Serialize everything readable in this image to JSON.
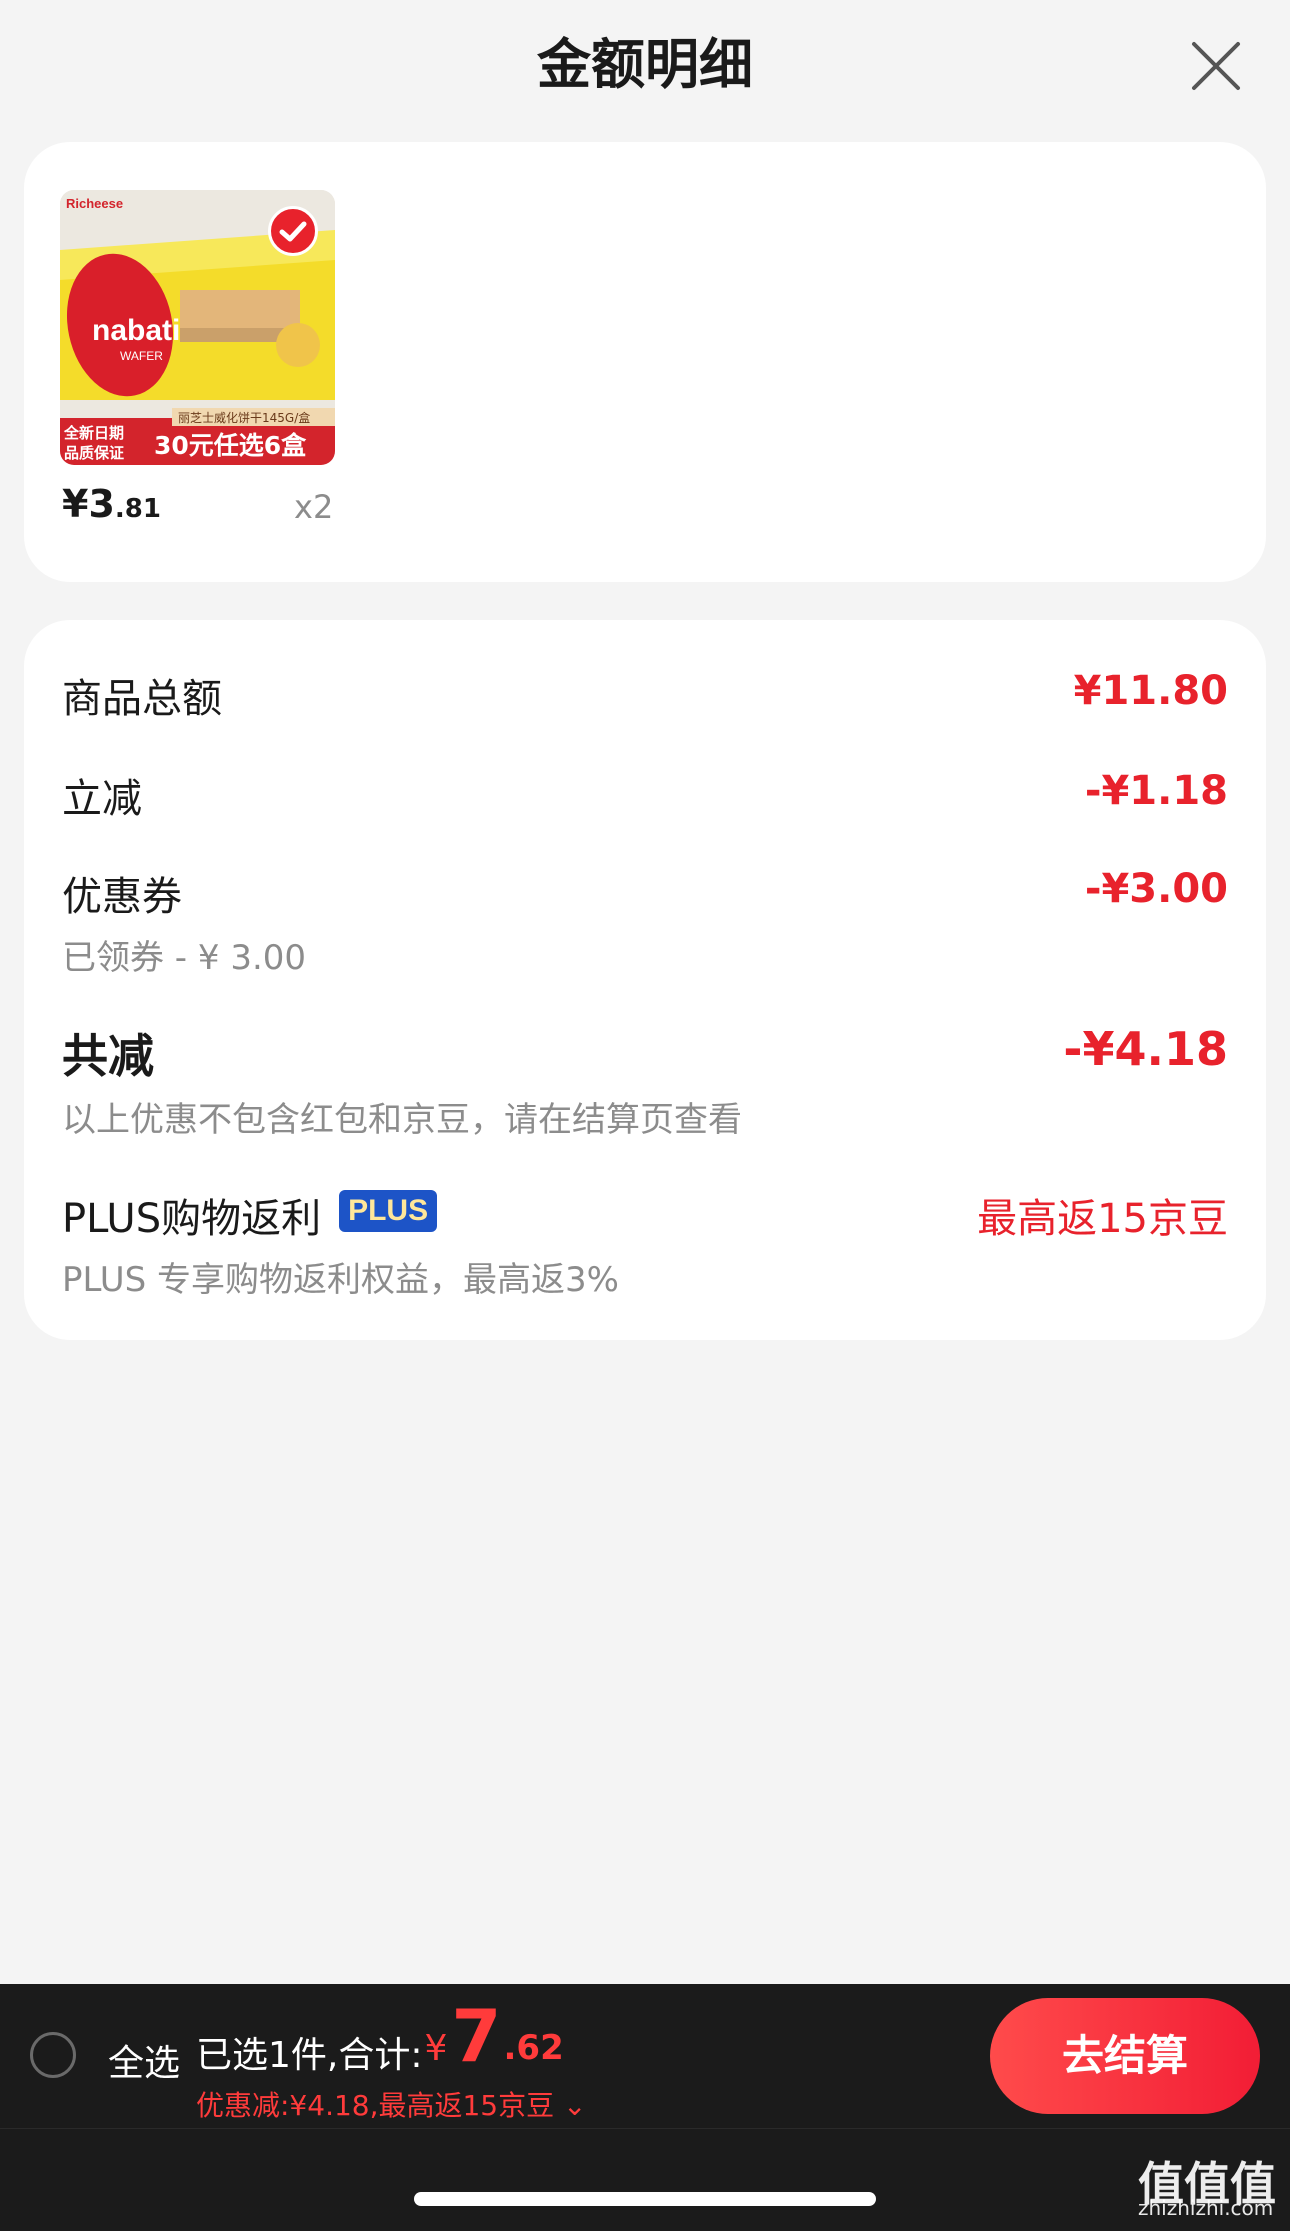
{
  "header": {
    "title": "金额明细"
  },
  "product": {
    "image_brand": "Richeese",
    "image_logo": "nabati",
    "image_logo_sub": "WAFER",
    "image_caption": "丽芝士威化饼干145G/盒",
    "image_promo_line1": "全新日期",
    "image_promo_line2": "品质保证",
    "image_promo_big": "30元任选6盒",
    "price_int": "¥3",
    "price_dec": ".81",
    "quantity": "x2",
    "selected": true
  },
  "summary": {
    "goods_total": {
      "label": "商品总额",
      "value": "¥11.80"
    },
    "instant": {
      "label": "立减",
      "value": "-¥1.18"
    },
    "coupon": {
      "label": "优惠券",
      "value": "-¥3.00",
      "sub": "已领券 - ¥ 3.00"
    },
    "total_off": {
      "label": "共减",
      "value": "-¥4.18",
      "sub": "以上优惠不包含红包和京豆，请在结算页查看"
    },
    "plus": {
      "label": "PLUS购物返利",
      "badge": "PLUS",
      "value": "最高返15京豆",
      "sub": "PLUS 专享购物返利权益，最高返3%"
    }
  },
  "bottom_bar": {
    "select_all": "全选",
    "selected_text": "已选1件,合计:",
    "total_symbol": "¥",
    "total_int": "7",
    "total_dec": ".62",
    "discount_text": "优惠减:¥4.18,最高返15京豆 ⌄",
    "checkout_label": "去结算"
  },
  "watermark": {
    "glyphs": "值值值",
    "url": "zhizhizhi.com"
  },
  "colors": {
    "accent": "#e8222c",
    "bar": "#1b1b1b",
    "plus_badge": "#1d54c7"
  }
}
